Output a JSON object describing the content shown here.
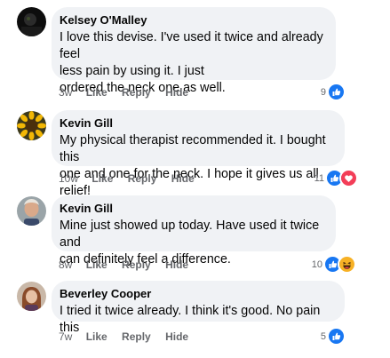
{
  "comments": [
    {
      "author": "Kelsey O'Malley",
      "text": "I love this devise. I've used it twice and already feel\nless pain by using it. I just\nordered the neck one as well.",
      "time": "3w",
      "like": "Like",
      "reply": "Reply",
      "hide": "Hide",
      "reaction_count": "9",
      "reactions": [
        "like-icon"
      ]
    },
    {
      "author": "Kevin Gill",
      "text": "My physical therapist recommended it. I bought this\none and one for the neck. I hope it gives us all relief!",
      "time": "10w",
      "like": "Like",
      "reply": "Reply",
      "hide": "Hide",
      "reaction_count": "11",
      "reactions": [
        "like-icon",
        "love-icon"
      ]
    },
    {
      "author": "Kevin Gill",
      "text": "Mine just showed up today. Have used it twice and\ncan definitely feel a difference.",
      "time": "8w",
      "like": "Like",
      "reply": "Reply",
      "hide": "Hide",
      "reaction_count": "10",
      "reactions": [
        "like-icon",
        "haha-icon"
      ]
    },
    {
      "author": "Beverley Cooper",
      "text": "I tried it twice already. I think it's good. No pain this",
      "time": "7w",
      "like": "Like",
      "reply": "Reply",
      "hide": "Hide",
      "reaction_count": "5",
      "reactions": [
        "like-icon"
      ]
    }
  ],
  "colors": {
    "like_blue": "#1877f2",
    "love_red": "#f33e58",
    "haha_yellow": "#f7b125",
    "bubble_bg": "#f0f2f5",
    "meta_gray": "#65676b"
  }
}
